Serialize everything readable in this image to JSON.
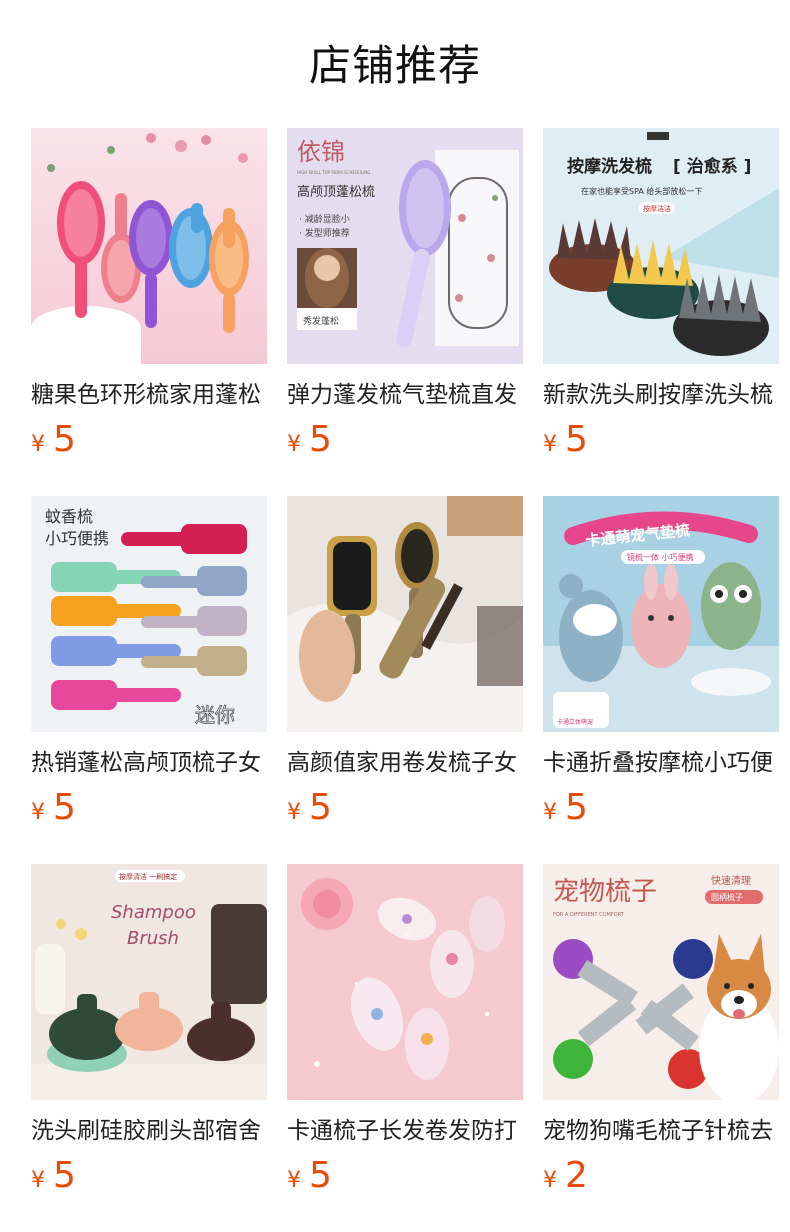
{
  "page": {
    "title": "店铺推荐"
  },
  "currency_symbol": "¥",
  "price_color": "#ee4a0b",
  "products": [
    {
      "name": "糖果色环形梳家用蓬松",
      "price": "5",
      "image": {
        "texts": []
      }
    },
    {
      "name": "弹力蓬发梳气垫梳直发",
      "price": "5",
      "image": {
        "texts": [
          "依锦",
          "HIGH SKULL TOP PERM SCHEDULING",
          "高颅顶蓬松梳",
          "· 减龄显脸小",
          "· 发型师推荐",
          "秀发蓬松"
        ]
      }
    },
    {
      "name": "新款洗头刷按摩洗头梳",
      "price": "5",
      "image": {
        "texts": [
          "按摩洗发梳",
          "[ 治愈系 ]",
          "在家也能享受SPA 给头部放松一下",
          "按摩洁洁"
        ]
      }
    },
    {
      "name": "热销蓬松高颅顶梳子女",
      "price": "5",
      "image": {
        "texts": [
          "蚊香梳",
          "小巧便携",
          "迷你"
        ]
      }
    },
    {
      "name": "高颜值家用卷发梳子女",
      "price": "5",
      "image": {
        "texts": []
      }
    },
    {
      "name": "卡通折叠按摩梳小巧便",
      "price": "5",
      "image": {
        "texts": [
          "卡通萌宠气垫梳",
          "镜梳一体 小巧便携",
          "卡通立体萌宠"
        ]
      }
    },
    {
      "name": "洗头刷硅胶刷头部宿舍",
      "price": "5",
      "image": {
        "texts": [
          "按摩清洁 一刷搞定",
          "Shampoo",
          "Brush"
        ]
      }
    },
    {
      "name": "卡通梳子长发卷发防打",
      "price": "5",
      "image": {
        "texts": []
      }
    },
    {
      "name": "宠物狗嘴毛梳子针梳去",
      "price": "2",
      "image": {
        "texts": [
          "宠物梳子",
          "快速清理",
          "圆柄梳子",
          "FOR A DIFFERENT COMFORT"
        ]
      }
    }
  ]
}
